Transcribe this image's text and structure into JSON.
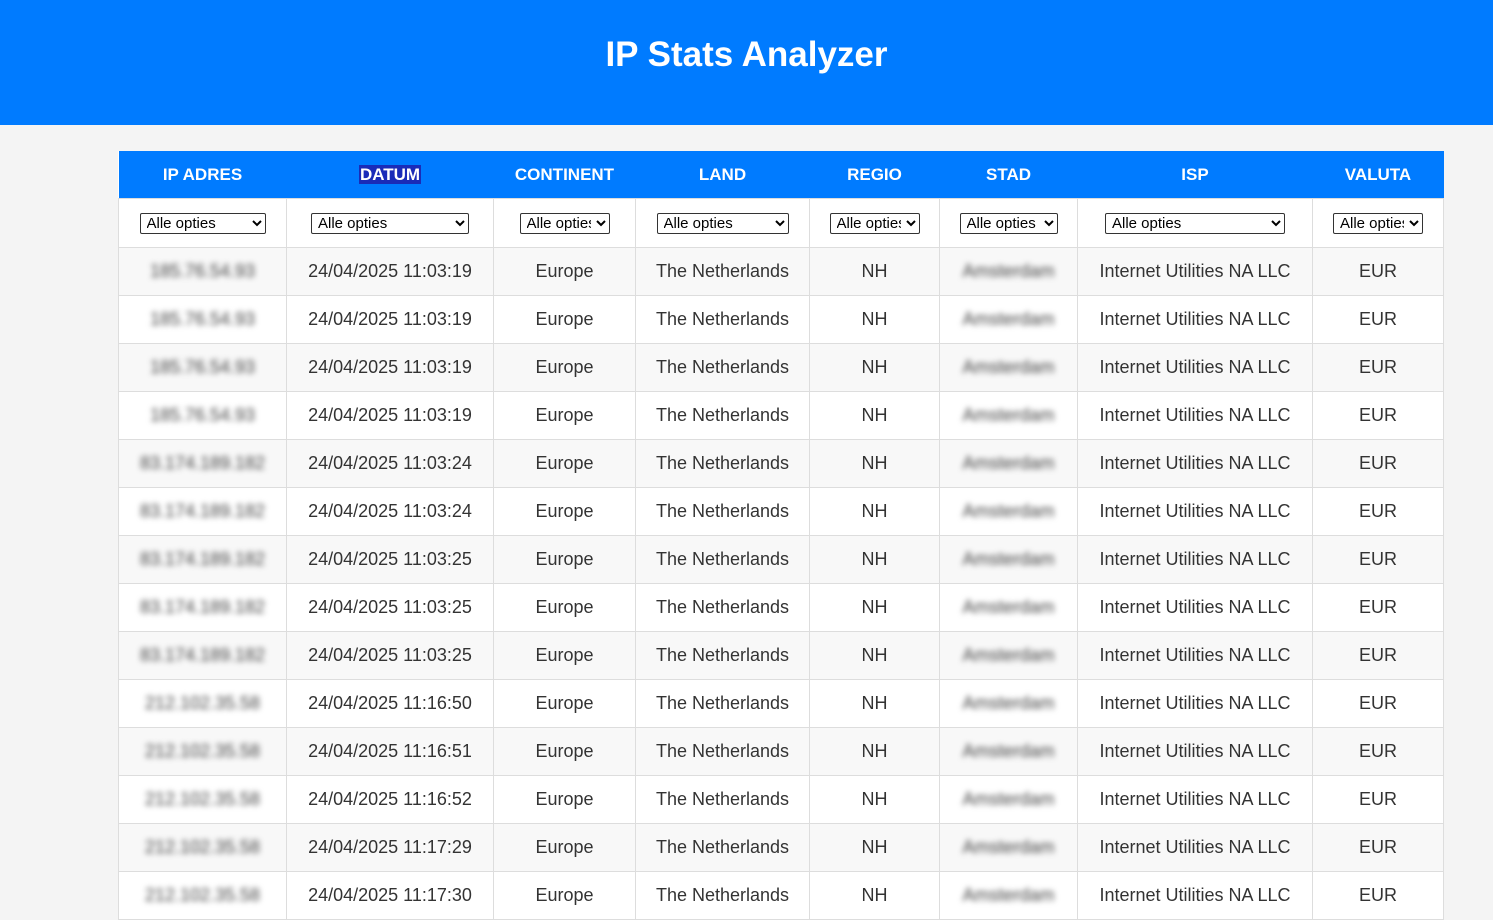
{
  "app": {
    "title": "IP Stats Analyzer"
  },
  "colors": {
    "header_bg": "#007bff",
    "highlight": "#1a2bb8"
  },
  "columns": [
    "IP ADRES",
    "DATUM",
    "CONTINENT",
    "LAND",
    "REGIO",
    "STAD",
    "ISP",
    "VALUTA"
  ],
  "filters": [
    "Alle opties",
    "Alle opties",
    "Alle opties",
    "Alle opties",
    "Alle opties",
    "Alle opties",
    "Alle opties",
    "Alle opties"
  ],
  "rows": [
    {
      "ip": "185.76.54.93",
      "date": "24/04/2025 11:03:19",
      "continent": "Europe",
      "country": "The Netherlands",
      "region": "NH",
      "city": "Amsterdam",
      "isp": "Internet Utilities NA LLC",
      "currency": "EUR"
    },
    {
      "ip": "185.76.54.93",
      "date": "24/04/2025 11:03:19",
      "continent": "Europe",
      "country": "The Netherlands",
      "region": "NH",
      "city": "Amsterdam",
      "isp": "Internet Utilities NA LLC",
      "currency": "EUR"
    },
    {
      "ip": "185.76.54.93",
      "date": "24/04/2025 11:03:19",
      "continent": "Europe",
      "country": "The Netherlands",
      "region": "NH",
      "city": "Amsterdam",
      "isp": "Internet Utilities NA LLC",
      "currency": "EUR"
    },
    {
      "ip": "185.76.54.93",
      "date": "24/04/2025 11:03:19",
      "continent": "Europe",
      "country": "The Netherlands",
      "region": "NH",
      "city": "Amsterdam",
      "isp": "Internet Utilities NA LLC",
      "currency": "EUR"
    },
    {
      "ip": "83.174.189.182",
      "date": "24/04/2025 11:03:24",
      "continent": "Europe",
      "country": "The Netherlands",
      "region": "NH",
      "city": "Amsterdam",
      "isp": "Internet Utilities NA LLC",
      "currency": "EUR"
    },
    {
      "ip": "83.174.189.182",
      "date": "24/04/2025 11:03:24",
      "continent": "Europe",
      "country": "The Netherlands",
      "region": "NH",
      "city": "Amsterdam",
      "isp": "Internet Utilities NA LLC",
      "currency": "EUR"
    },
    {
      "ip": "83.174.189.182",
      "date": "24/04/2025 11:03:25",
      "continent": "Europe",
      "country": "The Netherlands",
      "region": "NH",
      "city": "Amsterdam",
      "isp": "Internet Utilities NA LLC",
      "currency": "EUR"
    },
    {
      "ip": "83.174.189.182",
      "date": "24/04/2025 11:03:25",
      "continent": "Europe",
      "country": "The Netherlands",
      "region": "NH",
      "city": "Amsterdam",
      "isp": "Internet Utilities NA LLC",
      "currency": "EUR"
    },
    {
      "ip": "83.174.189.182",
      "date": "24/04/2025 11:03:25",
      "continent": "Europe",
      "country": "The Netherlands",
      "region": "NH",
      "city": "Amsterdam",
      "isp": "Internet Utilities NA LLC",
      "currency": "EUR"
    },
    {
      "ip": "212.102.35.58",
      "date": "24/04/2025 11:16:50",
      "continent": "Europe",
      "country": "The Netherlands",
      "region": "NH",
      "city": "Amsterdam",
      "isp": "Internet Utilities NA LLC",
      "currency": "EUR"
    },
    {
      "ip": "212.102.35.58",
      "date": "24/04/2025 11:16:51",
      "continent": "Europe",
      "country": "The Netherlands",
      "region": "NH",
      "city": "Amsterdam",
      "isp": "Internet Utilities NA LLC",
      "currency": "EUR"
    },
    {
      "ip": "212.102.35.58",
      "date": "24/04/2025 11:16:52",
      "continent": "Europe",
      "country": "The Netherlands",
      "region": "NH",
      "city": "Amsterdam",
      "isp": "Internet Utilities NA LLC",
      "currency": "EUR"
    },
    {
      "ip": "212.102.35.58",
      "date": "24/04/2025 11:17:29",
      "continent": "Europe",
      "country": "The Netherlands",
      "region": "NH",
      "city": "Amsterdam",
      "isp": "Internet Utilities NA LLC",
      "currency": "EUR"
    },
    {
      "ip": "212.102.35.58",
      "date": "24/04/2025 11:17:30",
      "continent": "Europe",
      "country": "The Netherlands",
      "region": "NH",
      "city": "Amsterdam",
      "isp": "Internet Utilities NA LLC",
      "currency": "EUR"
    }
  ]
}
